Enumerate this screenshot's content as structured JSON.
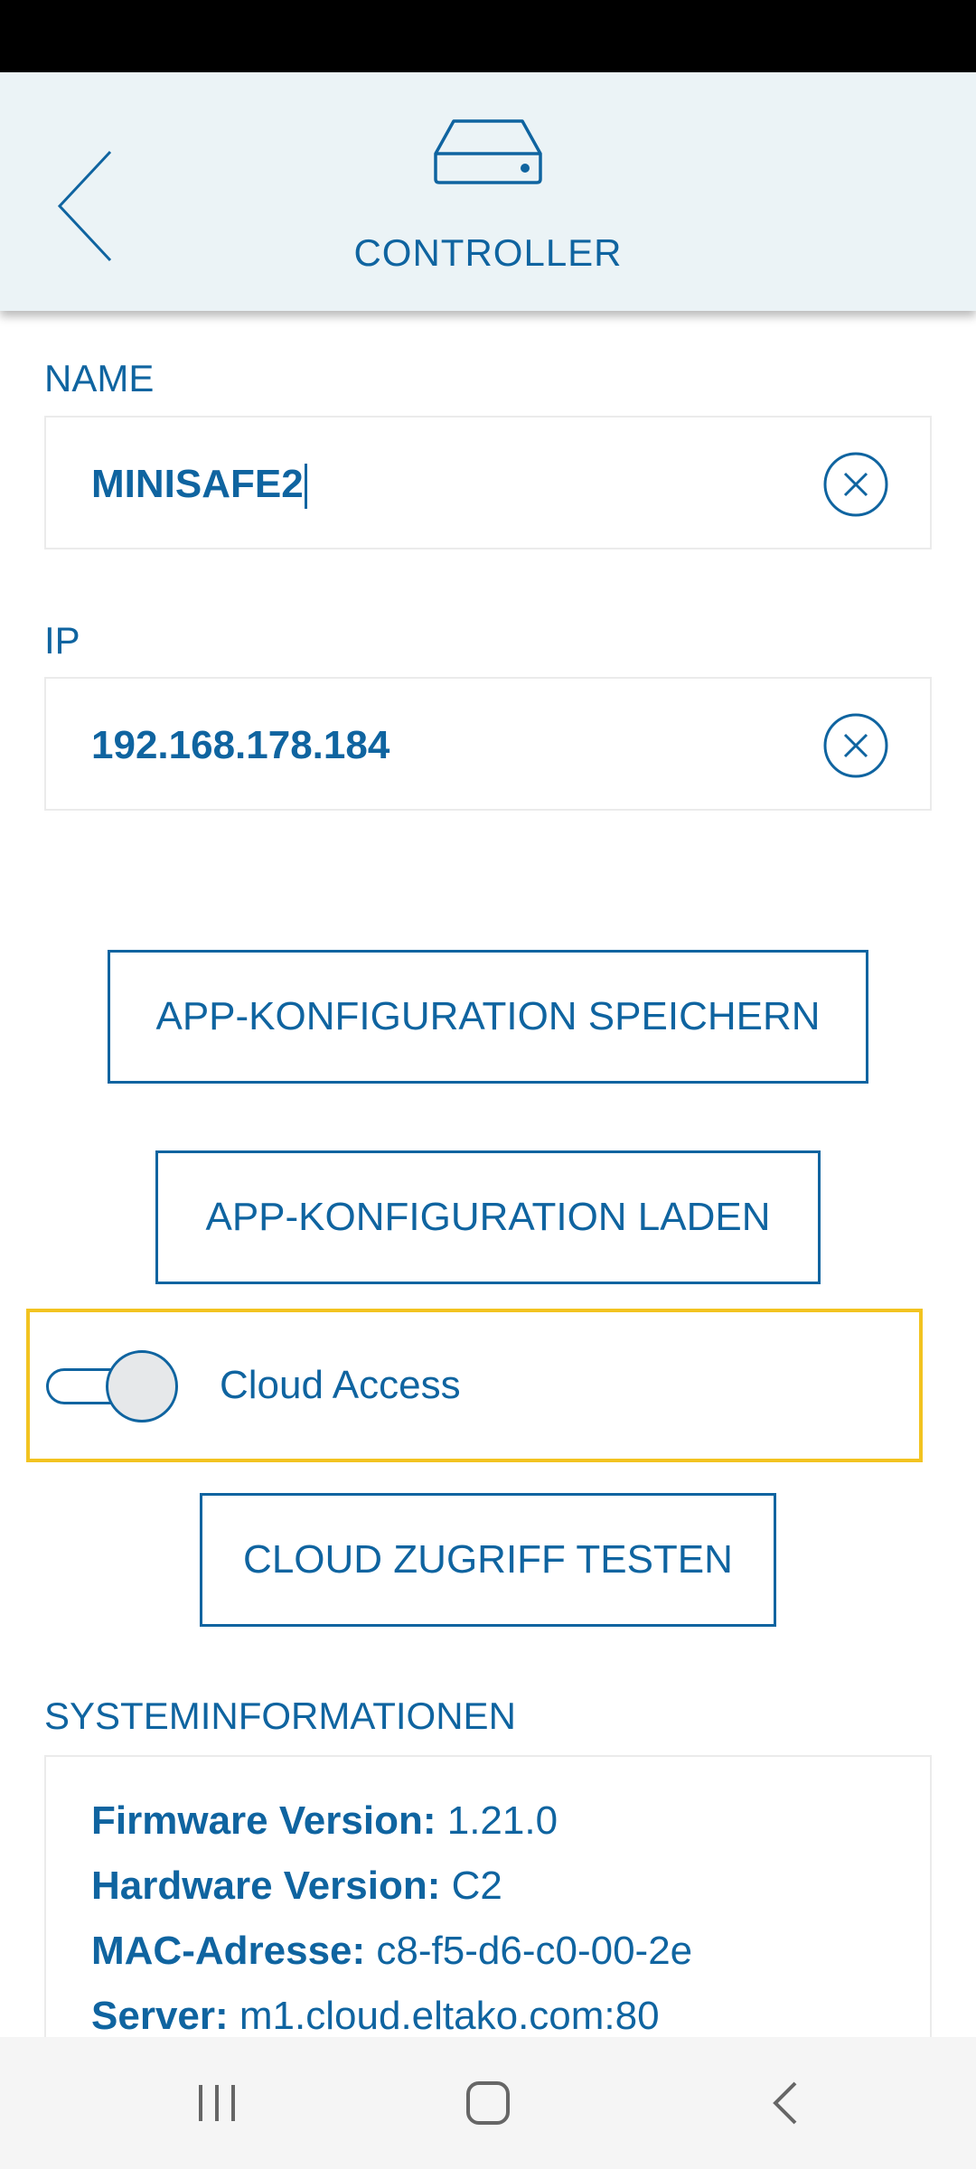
{
  "header": {
    "title": "CONTROLLER",
    "back_icon": "back-chevron-icon",
    "device_icon": "controller-device-icon"
  },
  "name_field": {
    "label": "NAME",
    "value": "MINISAFE2",
    "clear_icon": "clear-circle-icon"
  },
  "ip_field": {
    "label": "IP",
    "value": "192.168.178.184",
    "clear_icon": "clear-circle-icon"
  },
  "buttons": {
    "save_config": "APP-KONFIGURATION SPEICHERN",
    "load_config": "APP-KONFIGURATION LADEN",
    "test_cloud": "CLOUD ZUGRIFF TESTEN"
  },
  "cloud_access": {
    "label": "Cloud Access",
    "enabled": false,
    "highlight_color": "#f2c320"
  },
  "system_info": {
    "label": "SYSTEMINFORMATIONEN",
    "firmware": {
      "key": "Firmware Version:",
      "value": "1.21.0"
    },
    "hardware": {
      "key": "Hardware Version:",
      "value": "C2"
    },
    "mac": {
      "key": "MAC-Adresse:",
      "value": "c8-f5-d6-c0-00-2e"
    },
    "server": {
      "key": "Server:",
      "value": "m1.cloud.eltako.com:80"
    }
  },
  "nav": {
    "recents_icon": "recents-icon",
    "home_icon": "home-icon",
    "back_icon": "back-icon"
  },
  "colors": {
    "primary": "#0f64a0",
    "header_bg": "#ebf3f6"
  }
}
